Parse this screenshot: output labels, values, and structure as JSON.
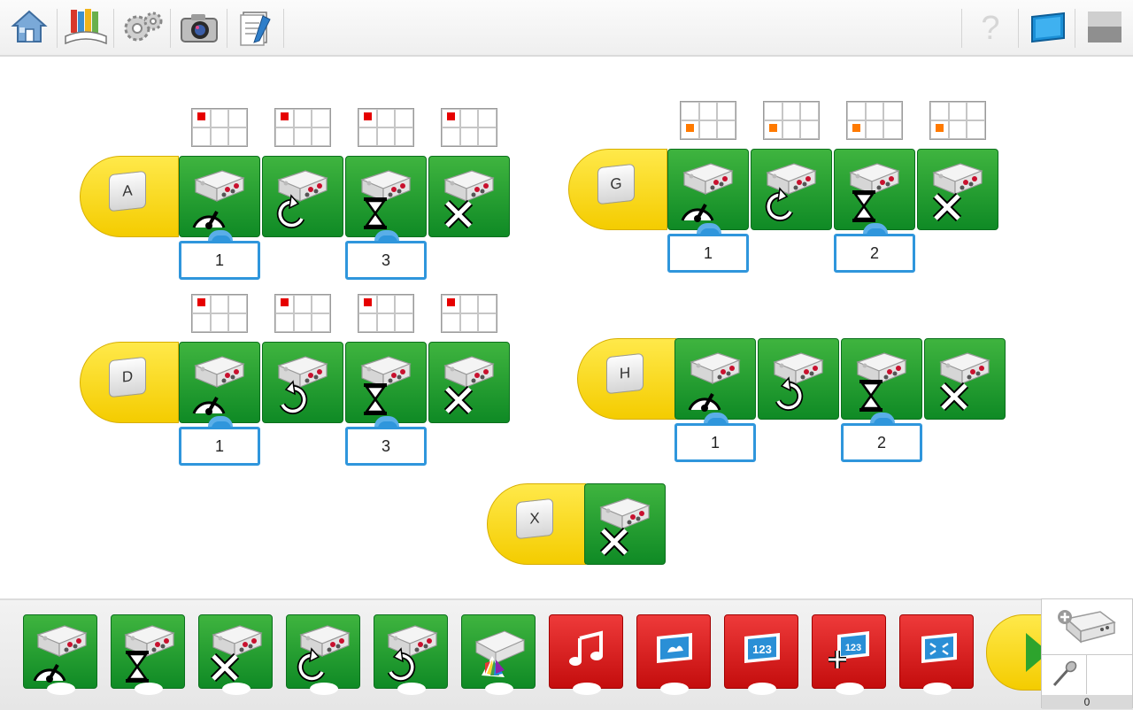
{
  "toolbar": {
    "home": "home-icon",
    "library": "library-icon",
    "settings": "gears-icon",
    "camera": "camera-icon",
    "docs": "documentation-icon",
    "help": "help-icon",
    "screen": "display-icon",
    "window": "window-icon"
  },
  "colors": {
    "block_green": "#1f9e2e",
    "start_yellow": "#f7d300",
    "input_blue": "#2f96dc",
    "red_block": "#d91a1a",
    "port_red": "#e60000",
    "port_orange": "#ff7a00"
  },
  "programs": [
    {
      "key": "A",
      "inputs": [
        "1",
        "3"
      ]
    },
    {
      "key": "G",
      "inputs": [
        "1",
        "2"
      ]
    },
    {
      "key": "D",
      "inputs": [
        "1",
        "3"
      ]
    },
    {
      "key": "H",
      "inputs": [
        "1",
        "2"
      ]
    },
    {
      "key": "X",
      "inputs": []
    }
  ],
  "palette": {
    "blocks": [
      "motor-power-icon",
      "motor-on-for-icon",
      "motor-off-icon",
      "motor-counterclockwise-icon",
      "motor-clockwise-icon",
      "hub-light-icon",
      "play-sound-icon",
      "display-background-icon",
      "display-number-icon",
      "add-to-display-icon",
      "shrink-display-icon"
    ]
  },
  "hub_panel": {
    "count": "0"
  }
}
